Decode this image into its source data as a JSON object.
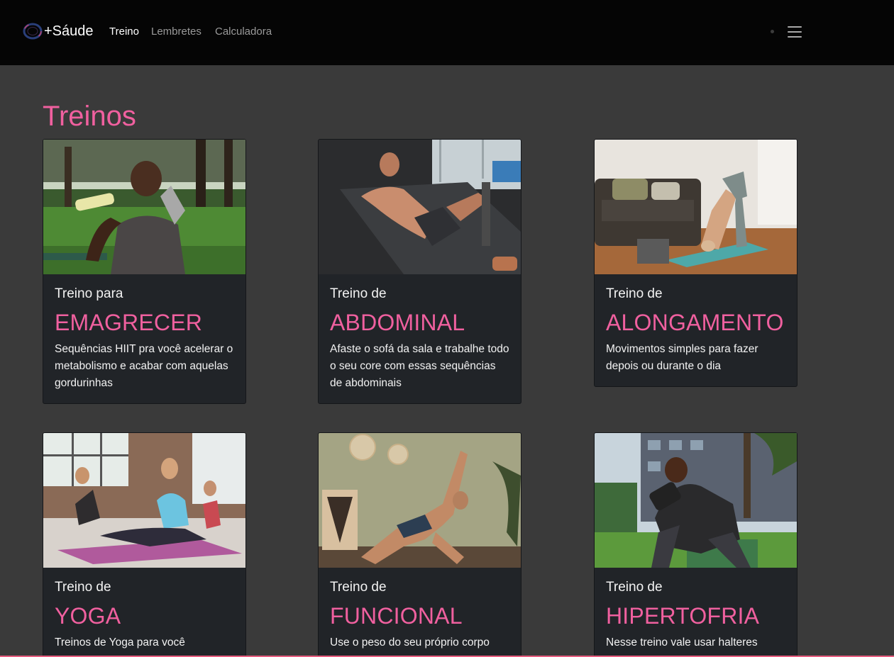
{
  "brand": {
    "name": "+Sáude"
  },
  "nav": {
    "links": [
      {
        "label": "Treino",
        "active": true
      },
      {
        "label": "Lembretes",
        "active": false
      },
      {
        "label": "Calculadora",
        "active": false
      }
    ]
  },
  "page": {
    "title": "Treinos"
  },
  "cards": [
    {
      "pre": "Treino para",
      "title": "EMAGRECER",
      "text": "Sequências HIIT pra você acelerar o metabolismo e acabar com aquelas gordurinhas"
    },
    {
      "pre": "Treino de",
      "title": "ABDOMINAL",
      "text": "Afaste o sofá da sala e trabalhe todo o seu core com essas sequências de abdominais"
    },
    {
      "pre": "Treino de",
      "title": "ALONGAMENTO",
      "text": "Movimentos simples para fazer depois ou durante o dia"
    },
    {
      "pre": "Treino de",
      "title": "YOGA",
      "text": "Treinos de Yoga para você"
    },
    {
      "pre": "Treino de",
      "title": "FUNCIONAL",
      "text": "Use o peso do seu próprio corpo"
    },
    {
      "pre": "Treino de",
      "title": "HIPERTOFRIA",
      "text": "Nesse treino vale usar halteres"
    }
  ],
  "colors": {
    "accent": "#f0609f",
    "navbar": "#050505",
    "background": "#3a3a3a",
    "card": "#212428"
  }
}
